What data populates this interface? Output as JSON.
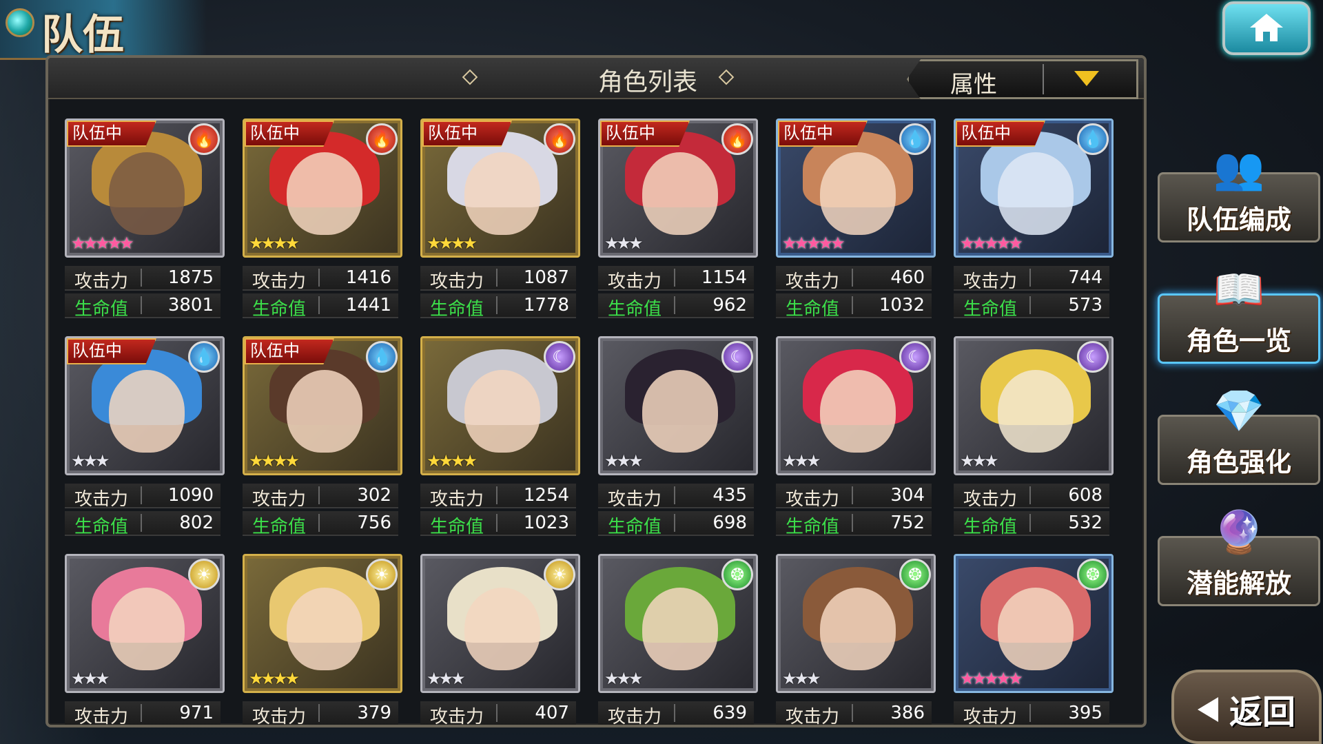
{
  "header": {
    "title": "队伍"
  },
  "panel": {
    "title": "角色列表",
    "sort_label": "属性"
  },
  "cards": [
    {
      "team": "队伍中",
      "element": "fire",
      "rarity": 5,
      "frame": "silver",
      "atk": "1875",
      "hp": "3801",
      "hair": "#b88a3a",
      "skin": "#7a5a44"
    },
    {
      "team": "队伍中",
      "element": "fire",
      "rarity": 4,
      "frame": "gold",
      "atk": "1416",
      "hp": "1441",
      "hair": "#d42a2a",
      "skin": "#f3d6c0"
    },
    {
      "team": "队伍中",
      "element": "fire",
      "rarity": 4,
      "frame": "gold",
      "atk": "1087",
      "hp": "1778",
      "hair": "#d8d8e4",
      "skin": "#f3d6c0"
    },
    {
      "team": "队伍中",
      "element": "fire",
      "rarity": 3,
      "frame": "silver",
      "atk": "1154",
      "hp": "962",
      "hair": "#c42a3a",
      "skin": "#f3d6c0"
    },
    {
      "team": "队伍中",
      "element": "water",
      "rarity": 5,
      "frame": "blue",
      "atk": "460",
      "hp": "1032",
      "hair": "#c8845a",
      "skin": "#f3d6c0"
    },
    {
      "team": "队伍中",
      "element": "water",
      "rarity": 5,
      "frame": "blue",
      "atk": "744",
      "hp": "573",
      "hair": "#aac8e8",
      "skin": "#dfe8f4"
    },
    {
      "team": "队伍中",
      "element": "water",
      "rarity": 3,
      "frame": "silver",
      "atk": "1090",
      "hp": "802",
      "hair": "#3a8ad8",
      "skin": "#f3d6c0"
    },
    {
      "team": "队伍中",
      "element": "water",
      "rarity": 4,
      "frame": "gold",
      "atk": "302",
      "hp": "756",
      "hair": "#5a3a2a",
      "skin": "#f3d6c0"
    },
    {
      "team": "",
      "element": "dark",
      "rarity": 4,
      "frame": "gold",
      "atk": "1254",
      "hp": "1023",
      "hair": "#c8c8d0",
      "skin": "#f3d6c0"
    },
    {
      "team": "",
      "element": "dark",
      "rarity": 3,
      "frame": "silver",
      "atk": "435",
      "hp": "698",
      "hair": "#2a2230",
      "skin": "#f3d6c0"
    },
    {
      "team": "",
      "element": "dark",
      "rarity": 3,
      "frame": "silver",
      "atk": "304",
      "hp": "752",
      "hair": "#d8284a",
      "skin": "#f3d6c0"
    },
    {
      "team": "",
      "element": "dark",
      "rarity": 3,
      "frame": "silver",
      "atk": "608",
      "hp": "532",
      "hair": "#e8c84a",
      "skin": "#f3e8d0"
    },
    {
      "team": "",
      "element": "light",
      "rarity": 3,
      "frame": "silver",
      "atk": "971",
      "hp": "",
      "hair": "#e87a9a",
      "skin": "#f3d6c0"
    },
    {
      "team": "",
      "element": "light",
      "rarity": 4,
      "frame": "gold",
      "atk": "379",
      "hp": "",
      "hair": "#e8c870",
      "skin": "#f3d6c0"
    },
    {
      "team": "",
      "element": "light",
      "rarity": 3,
      "frame": "silver",
      "atk": "407",
      "hp": "",
      "hair": "#e8e0c8",
      "skin": "#f3d6c0"
    },
    {
      "team": "",
      "element": "wind",
      "rarity": 3,
      "frame": "silver",
      "atk": "639",
      "hp": "",
      "hair": "#6aa83a",
      "skin": "#f3d6c0"
    },
    {
      "team": "",
      "element": "wind",
      "rarity": 3,
      "frame": "silver",
      "atk": "386",
      "hp": "",
      "hair": "#8a5a3a",
      "skin": "#f3d6c0"
    },
    {
      "team": "",
      "element": "wind",
      "rarity": 5,
      "frame": "blue",
      "atk": "395",
      "hp": "",
      "hair": "#d86a6a",
      "skin": "#f3d6c0"
    }
  ],
  "labels": {
    "atk": "攻击力",
    "hp": "生命值"
  },
  "elements": {
    "fire": "🔥",
    "water": "💧",
    "dark": "☾",
    "light": "☀",
    "wind": "❂"
  },
  "side_menu": [
    {
      "label": "队伍编成",
      "icon": "party-portraits-icon",
      "active": false
    },
    {
      "label": "角色一览",
      "icon": "book-icon",
      "active": true
    },
    {
      "label": "角色强化",
      "icon": "enhance-crystal-icon",
      "active": false
    },
    {
      "label": "潜能解放",
      "icon": "potential-orb-icon",
      "active": false
    }
  ],
  "back_label": "返回"
}
